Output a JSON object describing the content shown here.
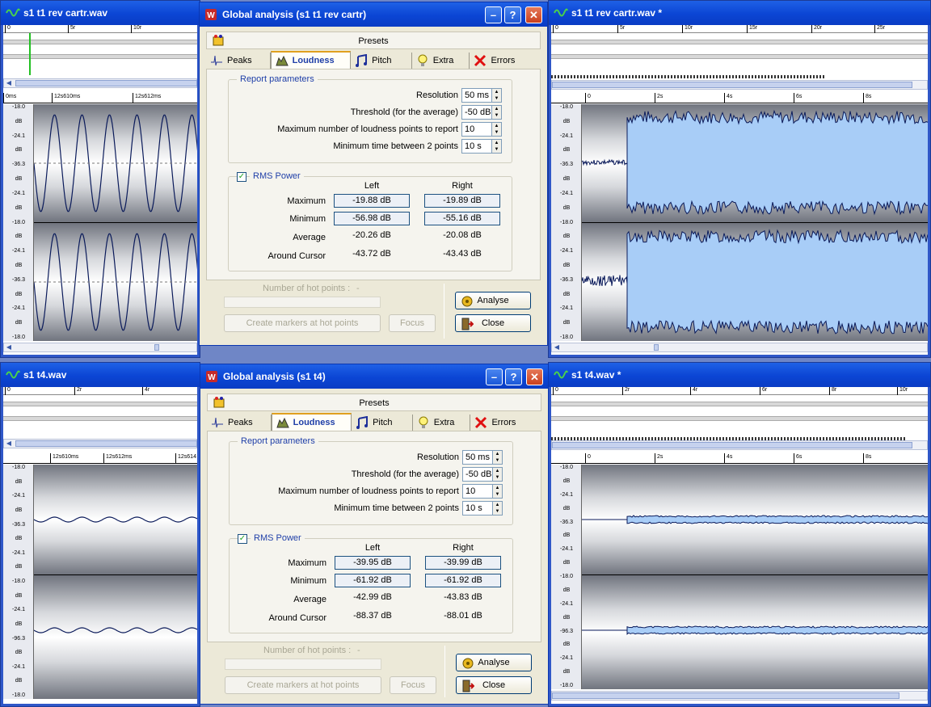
{
  "windows": {
    "tl": {
      "title": "s1 t1 rev cartr.wav",
      "ruler": [
        "0",
        "5r",
        "10r"
      ],
      "time": [
        "0ms",
        "12s610ms",
        "12s612ms"
      ]
    },
    "tr": {
      "title": "s1 t1 rev cartr.wav *",
      "ruler": [
        "0",
        "5r",
        "10r",
        "15r",
        "20r",
        "25r"
      ],
      "time": [
        "0",
        "2s",
        "4s",
        "6s",
        "8s"
      ]
    },
    "bl": {
      "title": "s1 t4.wav",
      "ruler": [
        "0",
        "2r",
        "4r"
      ],
      "time": [
        "12s610ms",
        "12s612ms",
        "12s614"
      ]
    },
    "br": {
      "title": "s1 t4.wav *",
      "ruler": [
        "0",
        "2r",
        "4r",
        "6r",
        "8r",
        "10r"
      ],
      "time": [
        "0",
        "2s",
        "4s",
        "6s",
        "8s"
      ]
    }
  },
  "db_labels": [
    "-18.0",
    "dB",
    "-24.1",
    "dB",
    "-36.3",
    "dB",
    "-24.1",
    "dB",
    "-18.0",
    "dB",
    "-24.1",
    "dB",
    "-36.3",
    "dB",
    "-24.1",
    "dB",
    "-18.0"
  ],
  "db_labels_b": [
    "-18.0",
    "dB",
    "-24.1",
    "dB",
    "-36.3",
    "dB",
    "-24.1",
    "dB",
    "-18.0",
    "dB",
    "-24.1",
    "dB",
    "-96.3",
    "dB",
    "-24.1",
    "dB",
    "-18.0"
  ],
  "dialog_common": {
    "presets": "Presets",
    "tabs": [
      "Peaks",
      "Loudness",
      "Pitch",
      "Extra",
      "Errors"
    ],
    "report_params": "Report parameters",
    "resolution_label": "Resolution",
    "resolution": "50 ms",
    "threshold_label": "Threshold (for the average)",
    "threshold": "-50 dB",
    "maxpoints_label": "Maximum number of loudness points to report",
    "maxpoints": "10",
    "mintime_label": "Minimum time between 2 points",
    "mintime": "10 s",
    "rms_label": "RMS Power",
    "col_left": "Left",
    "col_right": "Right",
    "row_max": "Maximum",
    "row_min": "Minimum",
    "row_avg": "Average",
    "row_cursor": "Around Cursor",
    "hot_points": "Number of hot points :",
    "hot_points_value": "-",
    "analyse": "Analyse",
    "close": "Close",
    "create_markers": "Create markers at hot points",
    "focus": "Focus",
    "check": "✓"
  },
  "dialogs": {
    "top": {
      "title": "Global analysis (s1 t1 rev cartr)",
      "max_l": "-19.88 dB",
      "max_r": "-19.89 dB",
      "min_l": "-56.98 dB",
      "min_r": "-55.16 dB",
      "avg_l": "-20.26 dB",
      "avg_r": "-20.08 dB",
      "cur_l": "-43.72 dB",
      "cur_r": "-43.43 dB"
    },
    "bottom": {
      "title": "Global analysis (s1 t4)",
      "max_l": "-39.95 dB",
      "max_r": "-39.99 dB",
      "min_l": "-61.92 dB",
      "min_r": "-61.92 dB",
      "avg_l": "-42.99 dB",
      "avg_r": "-43.83 dB",
      "cur_l": "-88.37 dB",
      "cur_r": "-88.01 dB"
    }
  },
  "icons": {
    "wave": "wave-icon",
    "presets": "presets-icon",
    "peaks": "peaks-icon",
    "loudness": "loudness-icon",
    "pitch": "pitch-icon",
    "extra": "bulb-icon",
    "errors": "x-icon"
  },
  "colors": {
    "xp_title": "#0b45d4",
    "waveform_fill": "#a8cdf7",
    "waveform_line": "#0a1a5a",
    "dialog_bg": "#ece9d8",
    "accent_text": "#1f3fa8",
    "cursor_green": "#22c022"
  }
}
